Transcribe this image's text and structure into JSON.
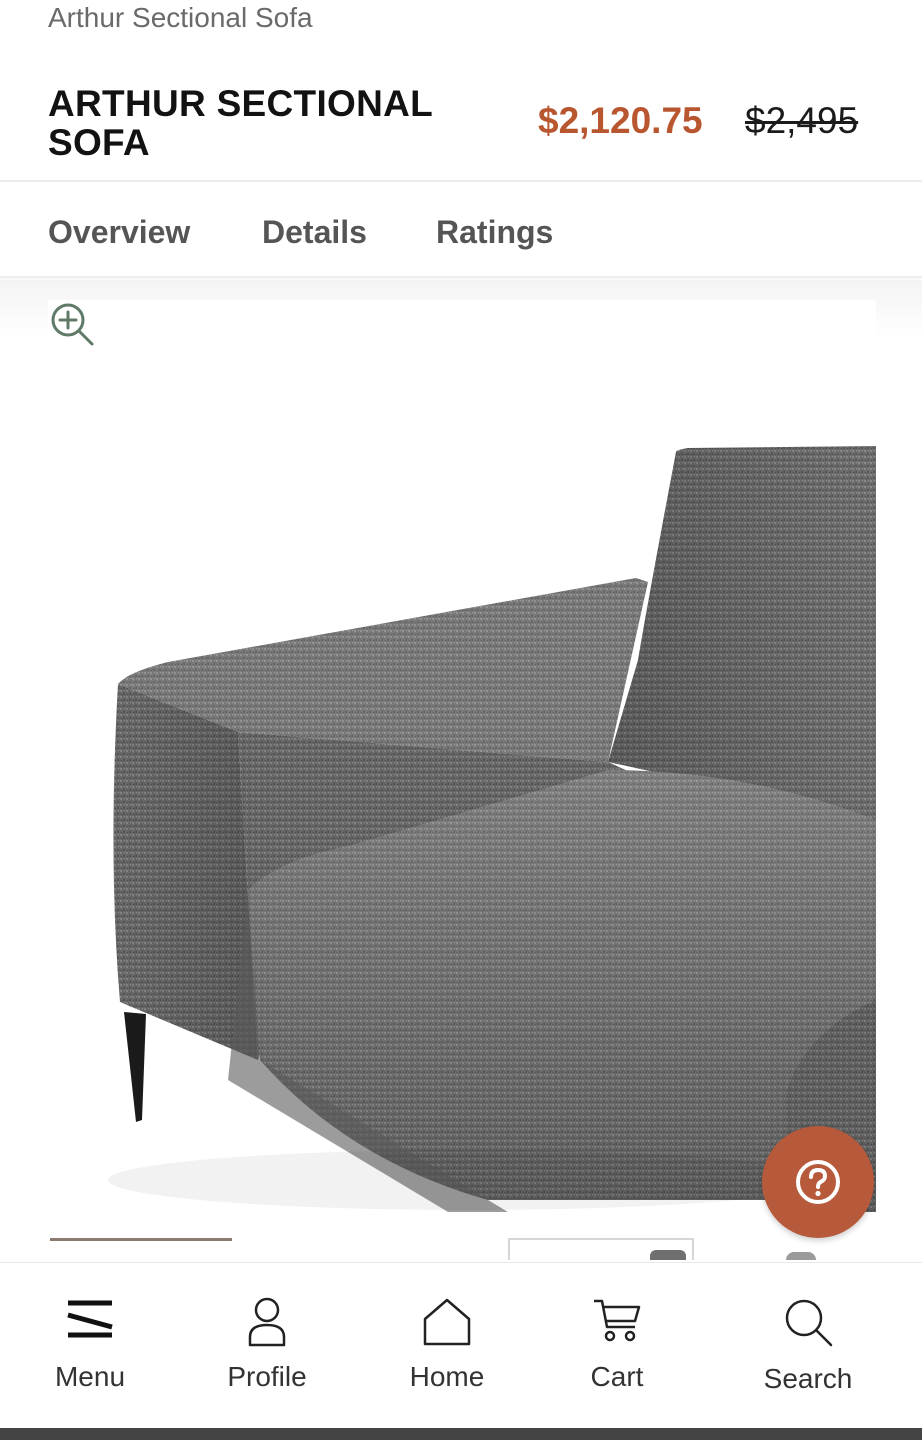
{
  "breadcrumb": {
    "text": "Arthur Sectional Sofa"
  },
  "product": {
    "title": "ARTHUR SECTIONAL SOFA",
    "sale_price": "$2,120.75",
    "original_price": "$2,495"
  },
  "tabs": [
    {
      "label": "Overview"
    },
    {
      "label": "Details"
    },
    {
      "label": "Ratings"
    }
  ],
  "gallery": {
    "zoom_icon": "zoom-in-icon",
    "help_icon": "question-mark-icon"
  },
  "bottom_nav": [
    {
      "label": "Menu",
      "icon": "menu-icon"
    },
    {
      "label": "Profile",
      "icon": "user-icon"
    },
    {
      "label": "Home",
      "icon": "home-icon"
    },
    {
      "label": "Cart",
      "icon": "cart-icon"
    },
    {
      "label": "Search",
      "icon": "search-icon"
    }
  ],
  "colors": {
    "sale_price": "#b8562f",
    "help_button": "#b65a3b",
    "sofa_fabric": "#6d6d6d",
    "zoom_icon": "#5f7a66"
  }
}
